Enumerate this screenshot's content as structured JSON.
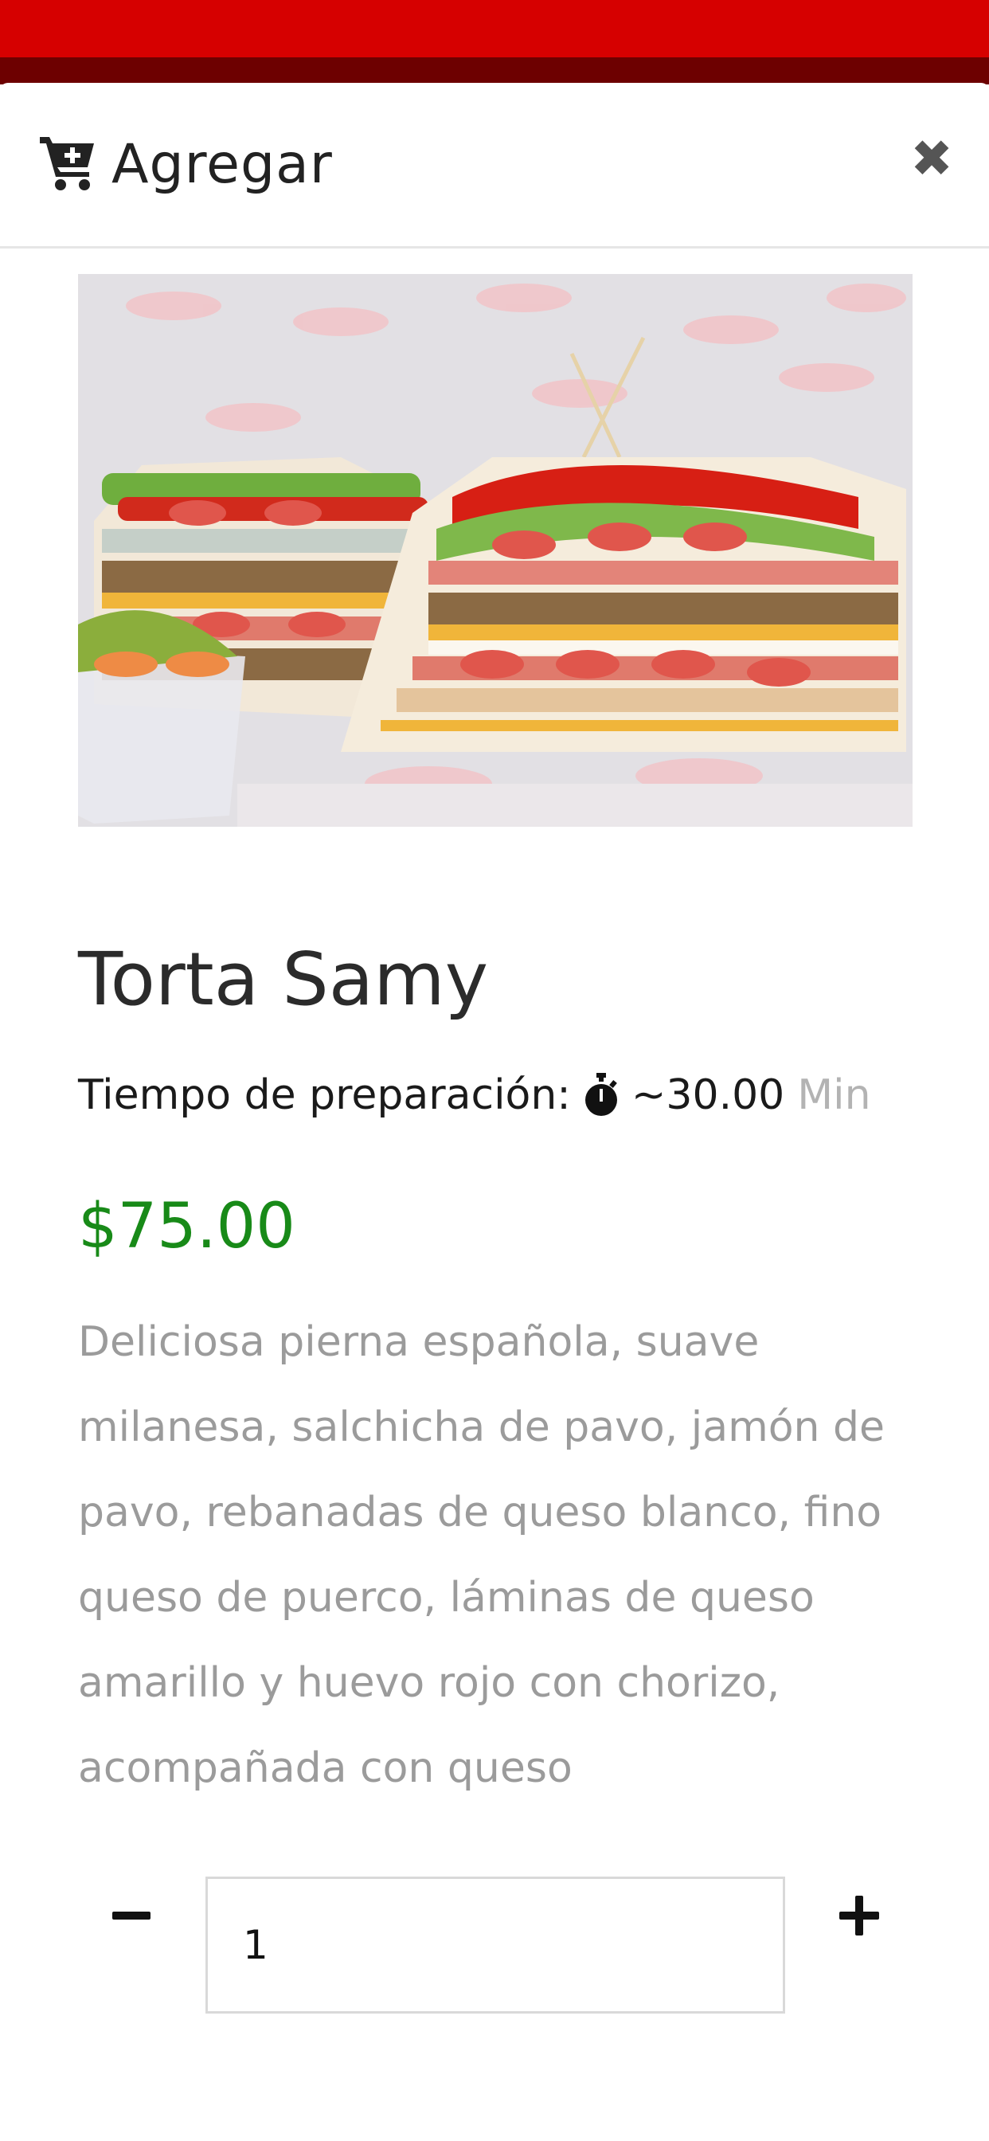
{
  "header": {
    "title": "Agregar",
    "cart_icon": "cart-plus-icon",
    "close_icon": "close-icon",
    "close_label": "✖"
  },
  "product": {
    "image_alt": "Torta Samy",
    "name": "Torta Samy",
    "prep_label": "Tiempo de preparación:",
    "prep_icon": "stopwatch-icon",
    "prep_value": "~30.00",
    "prep_unit": "Min",
    "price": "$75.00",
    "description": "Deliciosa pierna española, suave milanesa, salchicha de pavo, jamón de pavo, rebanadas de queso blanco, fino queso de puerco, láminas de queso amarillo y huevo rojo con chorizo, acompañada con queso"
  },
  "quantity": {
    "value": "1",
    "minus_icon": "minus-icon",
    "plus_icon": "plus-icon"
  },
  "colors": {
    "brand_red": "#d60000",
    "price_green": "#188a18",
    "muted_text": "#9b9b9b"
  }
}
